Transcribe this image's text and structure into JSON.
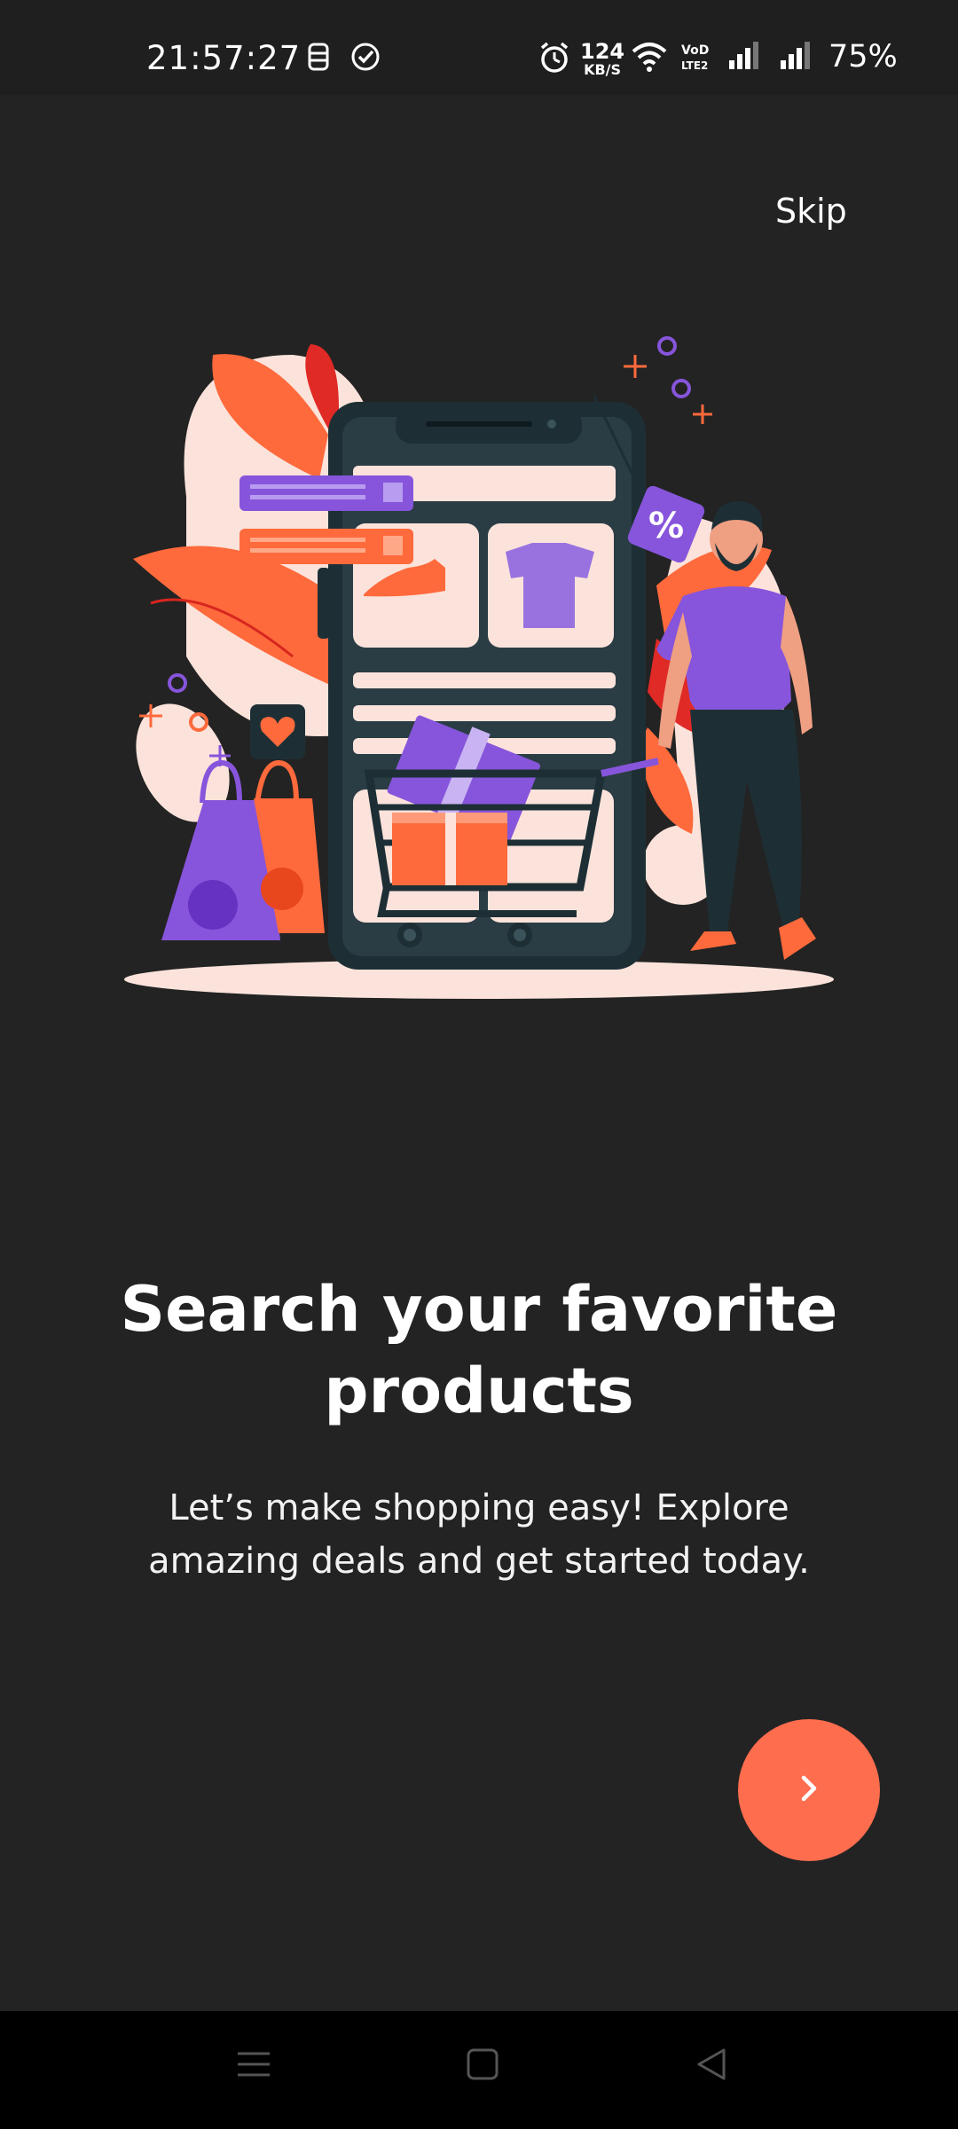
{
  "status_bar": {
    "time": "21:57:27",
    "net_speed_value": "124",
    "net_speed_unit": "KB/S",
    "battery": "75%",
    "icons": [
      "sim-status-icon",
      "check-circle-icon",
      "alarm-icon",
      "wifi-icon",
      "volte-icon",
      "signal-icon",
      "signal-icon"
    ]
  },
  "onboarding": {
    "skip_label": "Skip",
    "illustration": "online-shopping-illustration",
    "title": "Search your favorite products",
    "subtitle": "Let’s make shopping easy! Explore amazing deals and get started today.",
    "next_icon": "chevron-right-icon"
  },
  "navigation_bar": {
    "buttons": [
      "menu-icon",
      "home-icon",
      "back-icon"
    ]
  },
  "colors": {
    "background": "#232323",
    "accent": "#ff6d4f",
    "purple": "#7a45d6"
  }
}
